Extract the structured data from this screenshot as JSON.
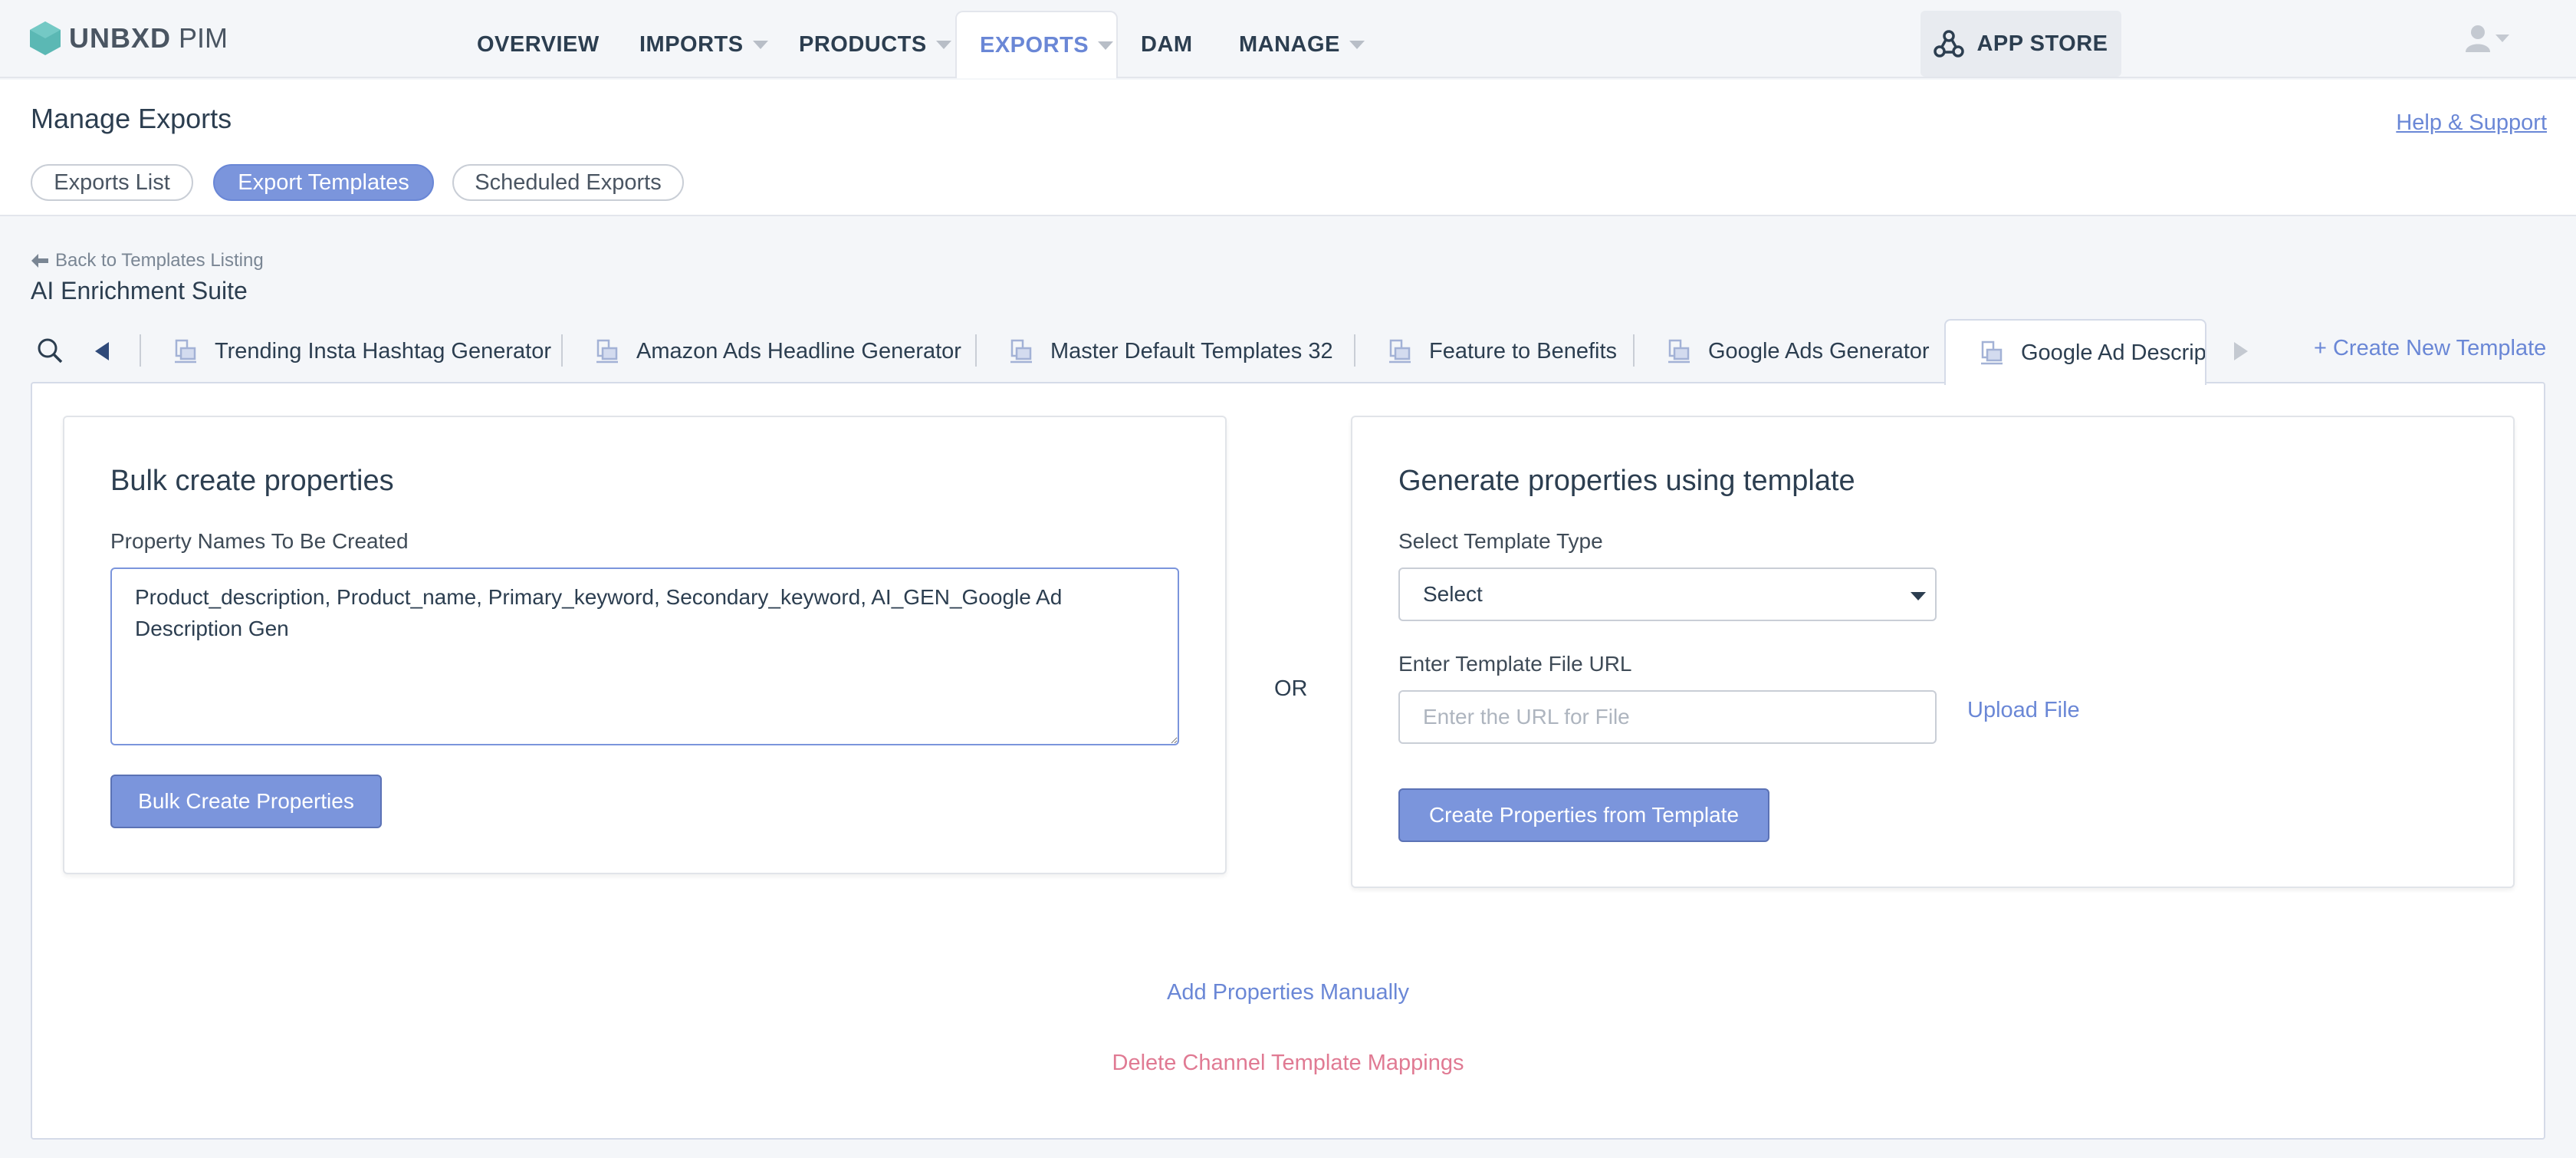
{
  "brand": {
    "name": "UNBXD",
    "product": "PIM",
    "accent": "#6a87d6",
    "logo_color": "#5bb8b4"
  },
  "nav": {
    "items": [
      {
        "label": "OVERVIEW",
        "has_dropdown": false
      },
      {
        "label": "IMPORTS",
        "has_dropdown": true
      },
      {
        "label": "PRODUCTS",
        "has_dropdown": true
      },
      {
        "label": "EXPORTS",
        "has_dropdown": true,
        "active": true
      },
      {
        "label": "DAM",
        "has_dropdown": false
      },
      {
        "label": "MANAGE",
        "has_dropdown": true
      }
    ],
    "app_store": "APP STORE",
    "icons": {
      "app_store": "app-store-icon",
      "user": "user-avatar-icon"
    }
  },
  "header": {
    "title": "Manage Exports",
    "help_link": "Help & Support",
    "pills": [
      {
        "label": "Exports List",
        "active": false
      },
      {
        "label": "Export Templates",
        "active": true
      },
      {
        "label": "Scheduled Exports",
        "active": false
      }
    ]
  },
  "content": {
    "back_link": "Back to Templates Listing",
    "suite_title": "AI Enrichment Suite",
    "tabs": [
      {
        "label": "Trending Insta Hashtag Generator",
        "active": false
      },
      {
        "label": "Amazon Ads Headline Generator",
        "active": false
      },
      {
        "label": "Master Default Templates 32",
        "active": false
      },
      {
        "label": "Feature to Benefits",
        "active": false
      },
      {
        "label": "Google Ads Generator",
        "active": false
      },
      {
        "label": "Google Ad Descript",
        "active": true
      }
    ],
    "create_template": "+ Create New Template"
  },
  "bulk": {
    "title": "Bulk create properties",
    "label": "Property Names To Be Created",
    "value": "Product_description, Product_name, Primary_keyword, Secondary_keyword, AI_GEN_Google Ad Description Gen",
    "button": "Bulk Create Properties"
  },
  "separator": "OR",
  "template": {
    "title": "Generate properties using template",
    "type_label": "Select Template Type",
    "type_value": "Select",
    "url_label": "Enter Template File URL",
    "url_placeholder": "Enter the URL for File",
    "upload": "Upload File",
    "button": "Create Properties from Template"
  },
  "footer_links": {
    "add_manual": "Add Properties Manually",
    "delete_mappings": "Delete Channel Template Mappings"
  }
}
